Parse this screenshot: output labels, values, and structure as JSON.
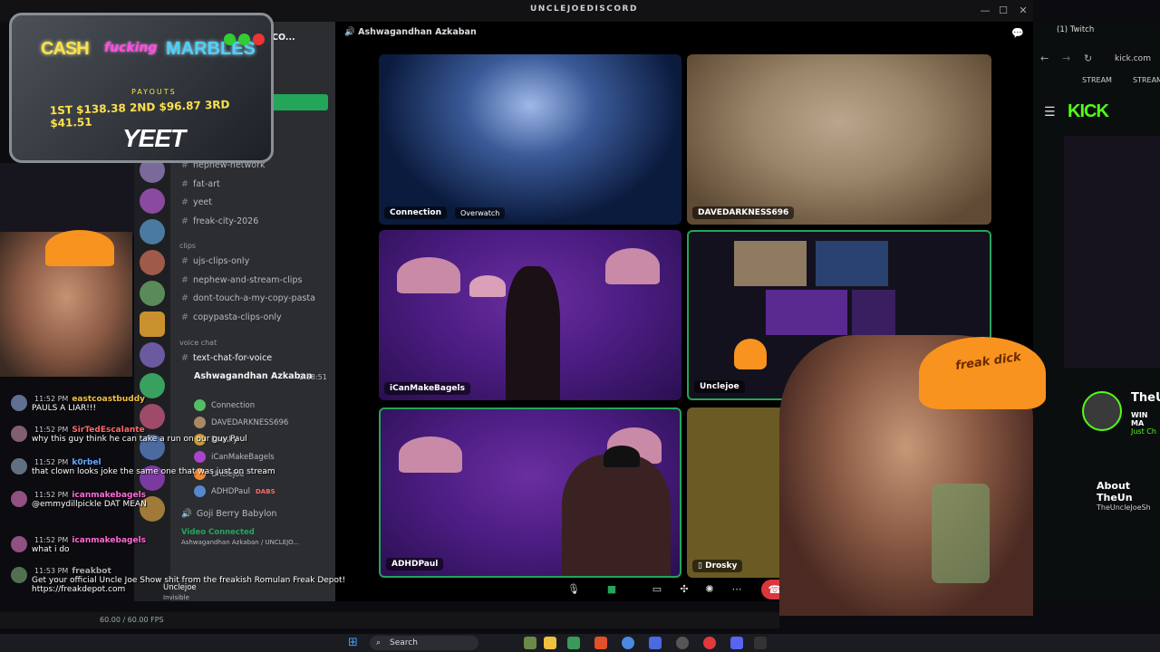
{
  "window": {
    "title": "UNCLEJOEDISCORD"
  },
  "discord": {
    "server_name": "CO...",
    "channels": [
      {
        "name": "nephew-network"
      },
      {
        "name": "fat-art"
      },
      {
        "name": "yeet"
      },
      {
        "name": "freak-city-2026"
      }
    ],
    "category_clips": "clips",
    "clip_channels": [
      {
        "name": "ujs-clips-only"
      },
      {
        "name": "nephew-and-stream-clips"
      },
      {
        "name": "dont-touch-a-my-copy-pasta"
      },
      {
        "name": "copypasta-clips-only"
      }
    ],
    "category_voice": "voice chat",
    "text_chat_voice": "text-chat-for-voice",
    "voice_channel": "Ashwagandhan Azkaban",
    "voice_timer": "2:58:51",
    "voice_users": [
      "Connection",
      "DAVEDARKNESS696",
      "Drosky",
      "iCanMakeBagels",
      "Unclejoe",
      "ADHDPaul"
    ],
    "dabs": "DABS",
    "goji_channel": "Goji Berry Babylon",
    "video_connected": "Video Connected",
    "connected_sub": "Ashwagandhan Azkaban / UNCLEJO...",
    "user_name": "Unclejoe",
    "user_status": "Invisible"
  },
  "call": {
    "channel_header": "Ashwagandhan Azkaban",
    "tiles": [
      {
        "name": "Connection",
        "badge": "Overwatch"
      },
      {
        "name": "DAVEDARKNESS696"
      },
      {
        "name": "iCanMakeBagels"
      },
      {
        "name": "Unclejoe"
      },
      {
        "name": "ADHDPaul"
      },
      {
        "name": "Drosky"
      }
    ]
  },
  "kick_browser": {
    "tab_title": "(1) Twitch",
    "url": "kick.com",
    "bookmarks": [
      "STREAM",
      "STREAM"
    ],
    "logo": "KICK",
    "channel_partial": "TheU",
    "win_partial": "WIN MA",
    "just_partial": "Just Ch",
    "about_partial": "About TheUn",
    "channel_partial2": "TheUncleJoeSh"
  },
  "overlay": {
    "cash": "CASH",
    "fucking": "fucking",
    "marbles": "MARBLES",
    "payouts": "PAYOUTS",
    "amounts": "1ST $138.38 2ND $96.87 3RD $41.51",
    "yeet": "YEET"
  },
  "cap_text": "freak dick",
  "chat": [
    {
      "time": "11:52 PM",
      "user": "eastcoastbuddy",
      "color": "#f0c040",
      "text": "PAULS A LIAR!!!"
    },
    {
      "time": "11:52 PM",
      "user": "SirTedEscalante",
      "color": "#ff6a6a",
      "text": "why this guy think he can take a run on our guy Paul"
    },
    {
      "time": "11:52 PM",
      "user": "k0rbel",
      "color": "#6aa8ff",
      "text": "that clown looks joke the same one that was just on stream"
    },
    {
      "time": "11:52 PM",
      "user": "icanmakebagels",
      "color": "#ff6ad5",
      "text": "@emmydillpickle DAT MEAN"
    },
    {
      "time": "11:52 PM",
      "user": "icanmakebagels",
      "color": "#ff6ad5",
      "text": "what i do"
    },
    {
      "time": "11:53 PM",
      "user": "freakbot",
      "color": "#aaaaaa",
      "text": "Get your official Uncle Joe Show shit from the freakish Romulan Freak Depot! https://freakdepot.com"
    }
  ],
  "obs": {
    "fps": "60.00 / 60.00 FPS"
  },
  "taskbar": {
    "search": "Search"
  }
}
